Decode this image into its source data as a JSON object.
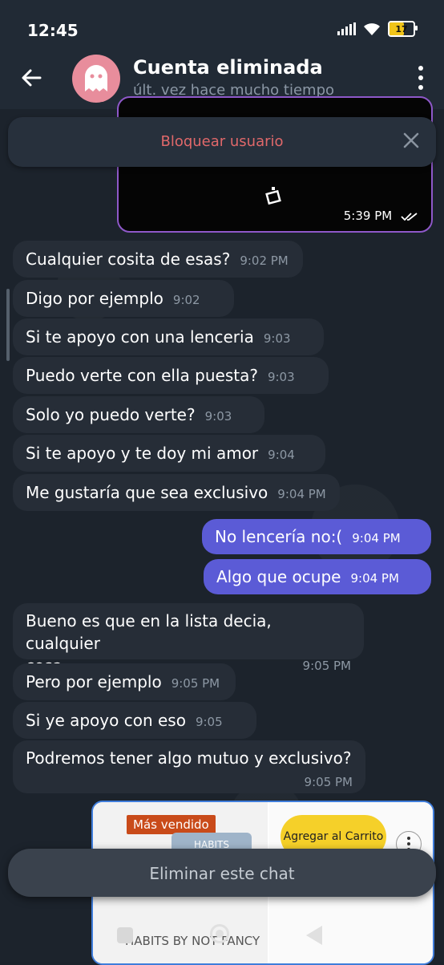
{
  "status": {
    "time": "12:45",
    "battery": "17"
  },
  "header": {
    "title": "Cuenta eliminada",
    "subtitle": "últ. vez hace mucho tiempo"
  },
  "media_message": {
    "time": "5:39 PM"
  },
  "block_bar": {
    "label": "Bloquear usuario"
  },
  "messages": [
    {
      "text": "Cualquier cosita de esas?",
      "time": "9:02 PM"
    },
    {
      "text": "Digo por ejemplo",
      "time": "9:02 PM"
    },
    {
      "text": "Si te apoyo con una lenceria",
      "time": "9:03 PM"
    },
    {
      "text": "Puedo verte con ella puesta?",
      "time": "9:03 PM"
    },
    {
      "text": "Solo yo puedo verte?",
      "time": "9:03 PM"
    },
    {
      "text": "Si te apoyo y te doy mi amor",
      "time": "9:04 PM"
    },
    {
      "text": "Me gustaría que sea exclusivo",
      "time": "9:04 PM"
    },
    {
      "text": "No lencería no:(",
      "time": "9:04 PM"
    },
    {
      "text": "Algo que ocupe",
      "time": "9:04 PM"
    },
    {
      "line1": "Bueno es que en la lista decia, cualquier",
      "line2": "cosa",
      "time": "9:05 PM"
    },
    {
      "text": "Pero por ejemplo",
      "time": "9:05 PM"
    },
    {
      "text": "Si ye apoyo con eso",
      "time": "9:05 PM"
    },
    {
      "text": "Podremos tener algo mutuo y exclusivo?",
      "time": "9:05 PM"
    }
  ],
  "product": {
    "badge": "Más vendido",
    "can_label": "HABITS",
    "add_to_cart": "Agregar al Carrito",
    "name": "HABITS BY NOT FANCY"
  },
  "delete_bar": {
    "label": "Eliminar este chat"
  }
}
